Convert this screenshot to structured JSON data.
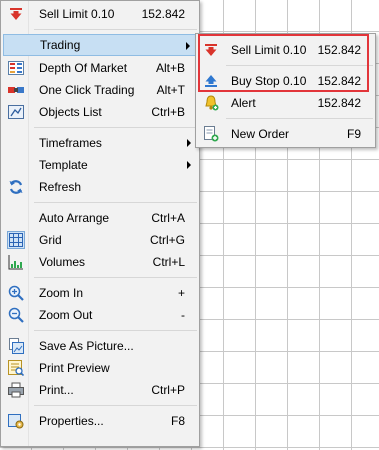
{
  "main_menu": {
    "items": [
      {
        "label": "Sell Limit 0.10",
        "shortcut": "152.842",
        "icon": "red-down-arrow-icon"
      },
      {
        "label": "Trading",
        "shortcut": "",
        "submenu": true,
        "highlighted": true
      },
      {
        "label": "Depth Of Market",
        "shortcut": "Alt+B",
        "icon": "depth-of-market-icon"
      },
      {
        "label": "One Click Trading",
        "shortcut": "Alt+T",
        "icon": "one-click-trading-icon"
      },
      {
        "label": "Objects List",
        "shortcut": "Ctrl+B",
        "icon": "objects-list-icon"
      },
      {
        "label": "Timeframes",
        "shortcut": "",
        "submenu": true
      },
      {
        "label": "Template",
        "shortcut": "",
        "submenu": true
      },
      {
        "label": "Refresh",
        "shortcut": "",
        "icon": "refresh-icon"
      },
      {
        "label": "Auto Arrange",
        "shortcut": "Ctrl+A"
      },
      {
        "label": "Grid",
        "shortcut": "Ctrl+G",
        "icon": "grid-icon"
      },
      {
        "label": "Volumes",
        "shortcut": "Ctrl+L",
        "icon": "volumes-icon"
      },
      {
        "label": "Zoom In",
        "shortcut": "+",
        "icon": "zoom-in-icon"
      },
      {
        "label": "Zoom Out",
        "shortcut": "-",
        "icon": "zoom-out-icon"
      },
      {
        "label": "Save As Picture...",
        "shortcut": "",
        "icon": "save-picture-icon"
      },
      {
        "label": "Print Preview",
        "shortcut": "",
        "icon": "print-preview-icon"
      },
      {
        "label": "Print...",
        "shortcut": "Ctrl+P",
        "icon": "printer-icon"
      },
      {
        "label": "Properties...",
        "shortcut": "F8",
        "icon": "properties-icon"
      }
    ]
  },
  "trading_submenu": {
    "items": [
      {
        "label": "Sell Limit 0.10",
        "value": "152.842",
        "icon": "red-down-arrow-icon"
      },
      {
        "label": "Buy Stop 0.10",
        "value": "152.842",
        "icon": "blue-up-arrow-icon"
      },
      {
        "label": "Alert",
        "value": "152.842",
        "icon": "alert-bell-icon"
      },
      {
        "label": "New Order",
        "value": "F9",
        "icon": "new-order-icon"
      }
    ]
  },
  "colors": {
    "highlight_bg": "#c7dff3",
    "highlight_border": "#8fbce3",
    "annotation_red": "#e2353a",
    "menu_bg": "#f2f2f2"
  }
}
